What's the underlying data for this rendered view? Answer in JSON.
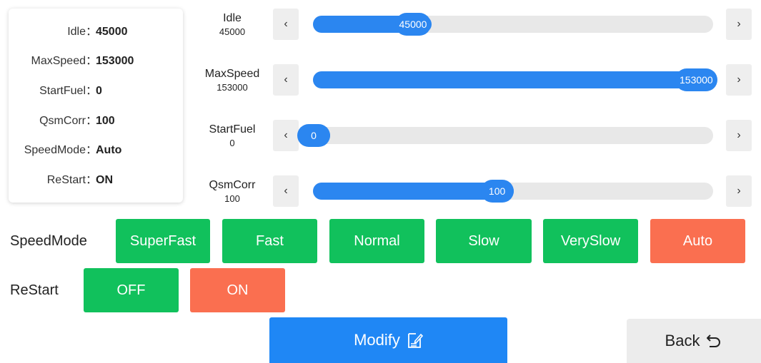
{
  "summary": [
    {
      "label": "Idle：",
      "value": "45000"
    },
    {
      "label": "MaxSpeed：",
      "value": "153000"
    },
    {
      "label": "StartFuel：",
      "value": "0"
    },
    {
      "label": "QsmCorr：",
      "value": "100"
    },
    {
      "label": "SpeedMode：",
      "value": "Auto"
    },
    {
      "label": "ReStart：",
      "value": "ON"
    }
  ],
  "sliders": [
    {
      "name": "Idle",
      "value": "45000",
      "fraction": 0.25
    },
    {
      "name": "MaxSpeed",
      "value": "153000",
      "fraction": 1.0
    },
    {
      "name": "StartFuel",
      "value": "0",
      "fraction": 0.0
    },
    {
      "name": "QsmCorr",
      "value": "100",
      "fraction": 0.46
    }
  ],
  "stepper": {
    "decrease": "‹",
    "increase": "›"
  },
  "speed_mode": {
    "label": "SpeedMode",
    "options": [
      "SuperFast",
      "Fast",
      "Normal",
      "Slow",
      "VerySlow",
      "Auto"
    ],
    "selected": "Auto"
  },
  "restart": {
    "label": "ReStart",
    "options": [
      "OFF",
      "ON"
    ],
    "selected": "ON"
  },
  "actions": {
    "modify": "Modify",
    "back": "Back"
  },
  "colors": {
    "accent_blue": "#2b86f0",
    "unselected_green": "#11c15c",
    "selected_orange": "#fa6f50"
  }
}
